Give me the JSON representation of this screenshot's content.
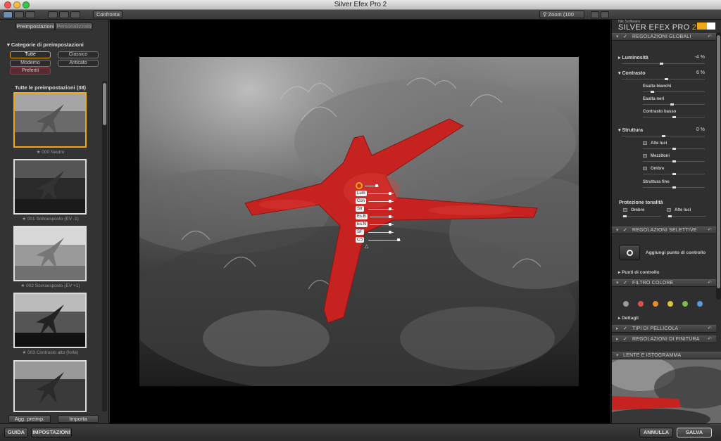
{
  "window": {
    "title": "Silver Efex Pro 2"
  },
  "colors": {
    "accent": "#f0a818",
    "close": "#fc5753",
    "minimize": "#fdbc40",
    "zoom": "#33c748",
    "preferiti": "#5a2a33",
    "starfish": "#c62320"
  },
  "toolbar": {
    "compare_label": "Confronta",
    "zoom_label": "Zoom (100 %)"
  },
  "left": {
    "tab_presets": "Preimpostazioni",
    "tab_custom": "Personalizzato",
    "categories_title": "Categorie di preimpostazioni",
    "categories": {
      "tutte": "Tutte",
      "classico": "Classico",
      "moderno": "Moderno",
      "anticato": "Anticato",
      "preferiti": "Preferiti"
    },
    "presets_title": "Tutte le preimpostazioni (38)",
    "presets": [
      "★ 000 Neutro",
      "★ 001 Sottoesposto (EV -1)",
      "★ 002 Sovraesposto (EV +1)",
      "★ 003 Contrasto alto (forte)",
      ""
    ],
    "add_preset_label": "Agg. preimp.",
    "import_label": "Importa"
  },
  "control_point": {
    "tags": [
      "Lum",
      "Con",
      "Str",
      "Es.B",
      "Es.N",
      "SF",
      "CS"
    ]
  },
  "right": {
    "brand_small": "Nik Software",
    "brand_main": "SILVER EFEX PRO",
    "brand_version": "2",
    "global": {
      "header": "REGOLAZIONI GLOBALI",
      "luminosita_label": "Luminosità",
      "luminosita_value": "-4  %",
      "contrasto_label": "Contrasto",
      "contrasto_value": "6  %",
      "esalta_bianchi": "Esalta bianchi",
      "esalta_neri": "Esalta neri",
      "contrasto_basso": "Contrasto basso",
      "struttura_label": "Struttura",
      "struttura_value": "0  %",
      "alte_luci": "Alte luci",
      "mezzitoni": "Mezzitoni",
      "ombre": "Ombre",
      "struttura_fine": "Struttura fine",
      "protezione_title": "Protezione tonalità",
      "protezione_ombre": "Ombre",
      "protezione_alte_luci": "Alte luci"
    },
    "selective": {
      "header": "REGOLAZIONI SELETTIVE",
      "add_cp_label": "Aggiungi punto di controllo",
      "control_points_label": "Punti di controllo"
    },
    "color_filter": {
      "header": "FILTRO COLORE",
      "swatches": [
        "#9a9a9a",
        "#d9534f",
        "#e88a2f",
        "#d9c53a",
        "#7fb94a",
        "#5b9ad9"
      ],
      "details_label": "Dettagli"
    },
    "film_types_header": "TIPI DI PELLICOLA",
    "finishing_header": "REGOLAZIONI DI FINITURA",
    "lens_header": "LENTE E ISTOGRAMMA"
  },
  "bottom": {
    "help_label": "GUIDA",
    "settings_label": "IMPOSTAZIONI",
    "cancel_label": "ANNULLA",
    "save_label": "SALVA"
  }
}
